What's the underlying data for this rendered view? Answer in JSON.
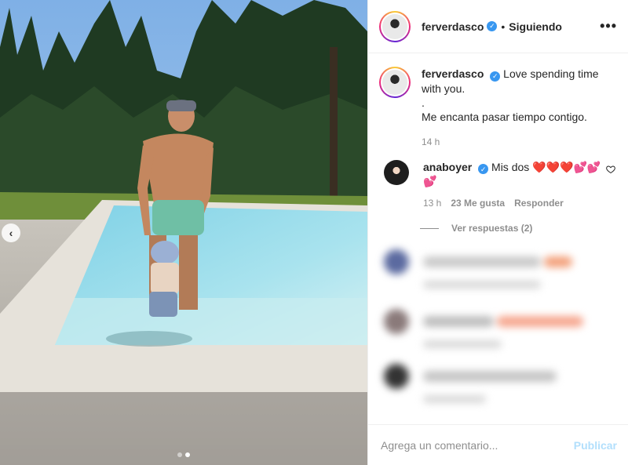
{
  "header": {
    "username": "ferverdasco",
    "separator": "•",
    "follow_status": "Siguiendo",
    "more_label": "•••"
  },
  "caption": {
    "username": "ferverdasco",
    "text": "Love spending time with you.\n.\nMe encanta pasar tiempo contigo.",
    "time": "14 h"
  },
  "comments": [
    {
      "username": "anaboyer",
      "text": "Mis dos",
      "emoji": "❤️❤️❤️💕💕💕",
      "time": "13 h",
      "likes": "23 Me gusta",
      "reply_label": "Responder",
      "view_replies": "Ver respuestas (2)"
    }
  ],
  "footer": {
    "placeholder": "Agrega un comentario...",
    "publish_label": "Publicar"
  },
  "carousel": {
    "prev_icon": "‹",
    "slide_count": 2,
    "active_slide": 2
  },
  "colors": {
    "verified": "#3897f0",
    "publish": "#b2dffc",
    "muted": "#8e8e8e",
    "text": "#262626"
  }
}
